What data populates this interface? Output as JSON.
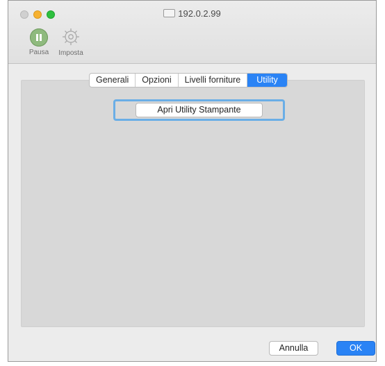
{
  "window": {
    "title": "192.0.2.99"
  },
  "toolbar": {
    "pause_label": "Pausa",
    "setup_label": "Imposta"
  },
  "tabs": [
    {
      "label": "Generali",
      "active": false
    },
    {
      "label": "Opzioni",
      "active": false
    },
    {
      "label": "Livelli forniture",
      "active": false
    },
    {
      "label": "Utility",
      "active": true
    }
  ],
  "main": {
    "open_utility_label": "Apri Utility Stampante"
  },
  "footer": {
    "cancel_label": "Annulla",
    "ok_label": "OK"
  },
  "colors": {
    "accent": "#2a83f5",
    "focus_ring": "#6aaee6",
    "pause_icon": "#8fba7e"
  }
}
